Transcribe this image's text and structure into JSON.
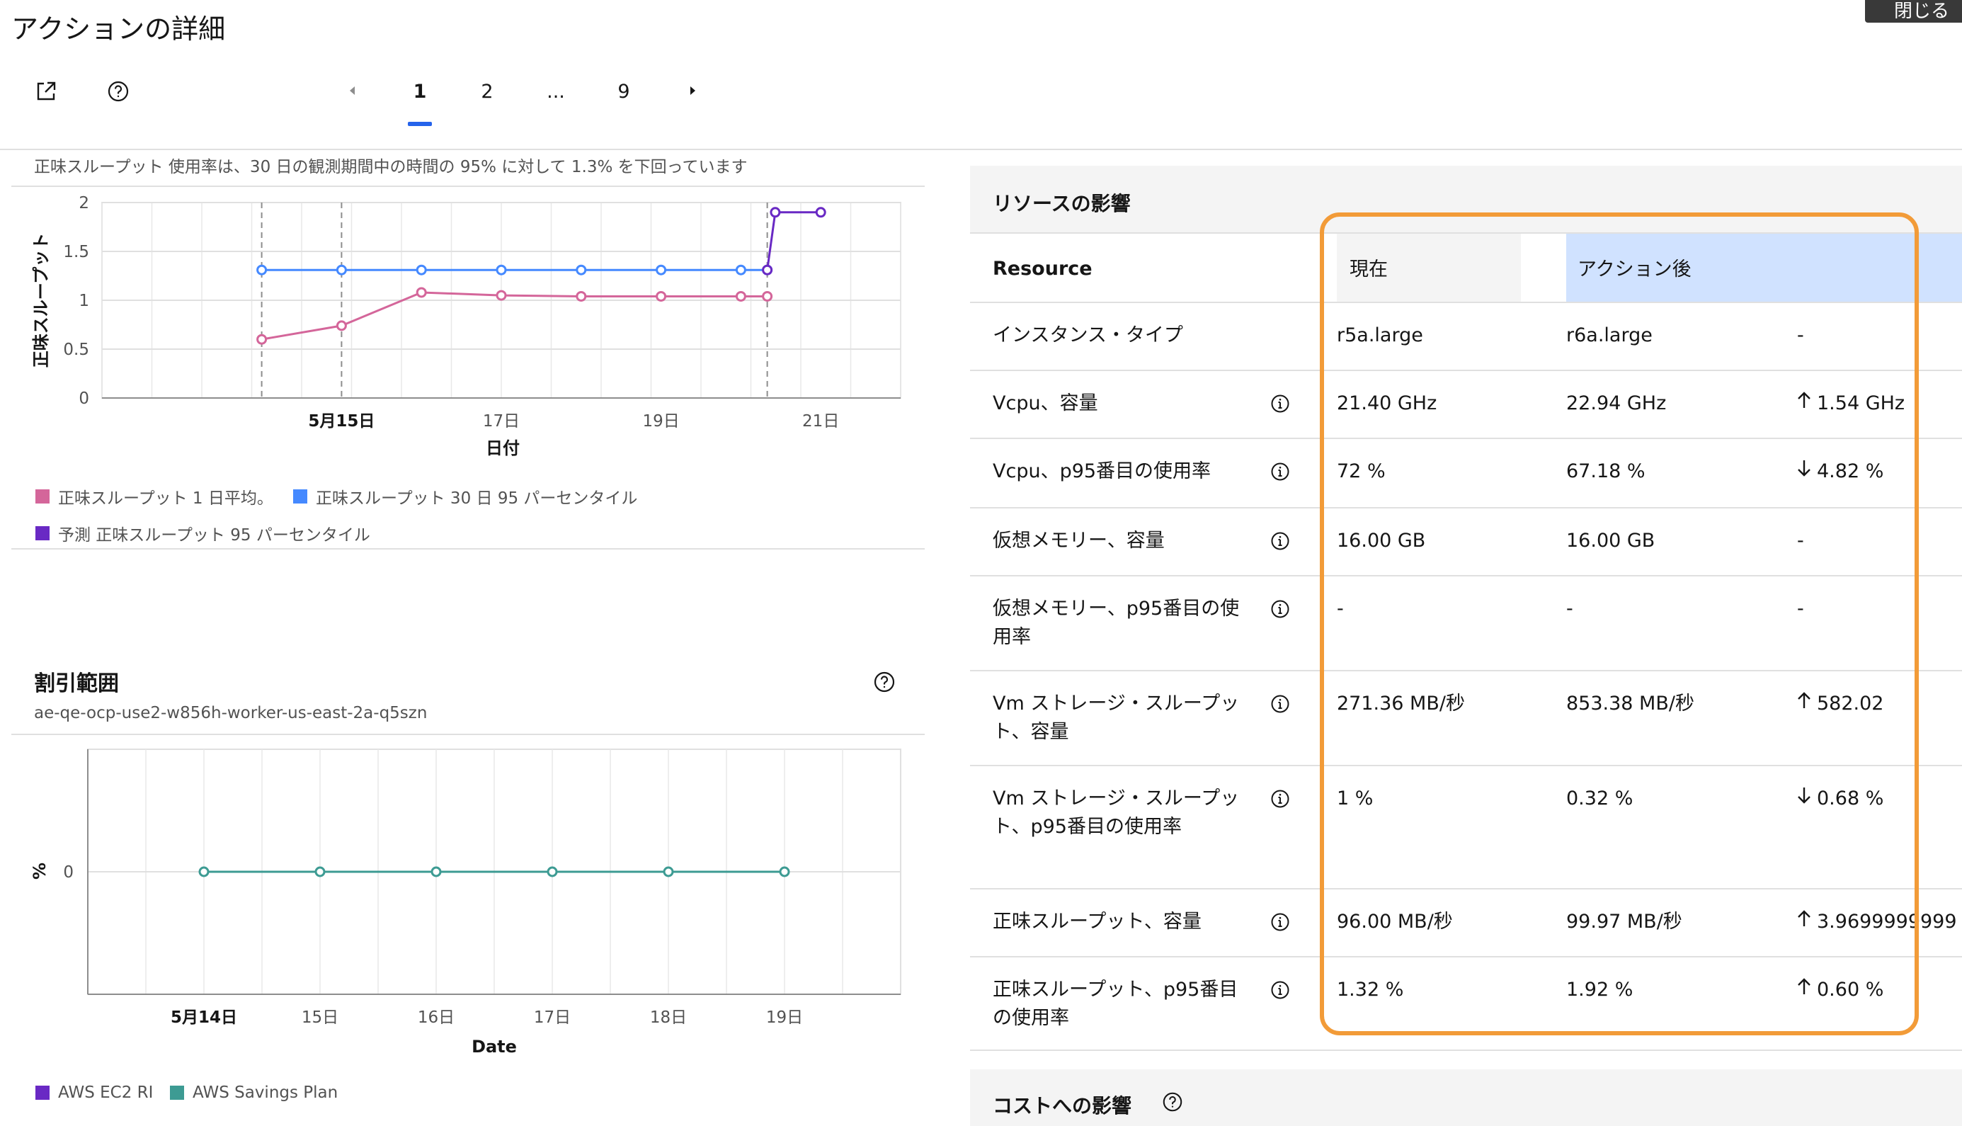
{
  "header": {
    "title": "アクションの詳細",
    "close_label": "閉じる",
    "icons": [
      "external-link-icon",
      "help-icon"
    ],
    "pagination": {
      "pages": [
        "1",
        "2",
        "...",
        "9"
      ],
      "active": "1"
    }
  },
  "throughput_chart": {
    "caption": "正味スループット 使用率は、30 日の観測期間中の時間の 95% に対して 1.3% を下回っています",
    "xlabel": "日付",
    "ylabel": "正味スループット",
    "legend": [
      "正味スループット 1 日平均。",
      "正味スループット 30 日 95 パーセンタイル",
      "予測 正味スループット 95 パーセンタイル"
    ]
  },
  "discount": {
    "title": "割引範囲",
    "subtitle": "ae-qe-ocp-use2-w856h-worker-us-east-2a-q5szn",
    "legend": [
      "AWS EC2 RI",
      "AWS Savings Plan"
    ]
  },
  "chart_data": [
    {
      "type": "line",
      "xlabel": "日付",
      "ylabel": "正味スループット",
      "x_ticks": [
        "5月15日",
        "17日",
        "19日",
        "21日"
      ],
      "y_ticks": [
        "0",
        "0.5",
        "1",
        "1.5",
        "2"
      ],
      "ylim": [
        0,
        2
      ],
      "x_range_days": [
        12,
        22
      ],
      "grid": true,
      "legend_position": "bottom",
      "series": [
        {
          "name": "正味スループット 1 日平均。",
          "color": "#d4669a",
          "points": [
            [
              14.0,
              0.6
            ],
            [
              15.0,
              0.74
            ],
            [
              16.0,
              1.08
            ],
            [
              17.0,
              1.05
            ],
            [
              18.0,
              1.04
            ],
            [
              19.0,
              1.04
            ],
            [
              20.0,
              1.04
            ],
            [
              20.33,
              1.04
            ]
          ]
        },
        {
          "name": "正味スループット 30 日 95 パーセンタイル",
          "color": "#4589ff",
          "points": [
            [
              14.0,
              1.31
            ],
            [
              15.0,
              1.31
            ],
            [
              16.0,
              1.31
            ],
            [
              17.0,
              1.31
            ],
            [
              18.0,
              1.31
            ],
            [
              19.0,
              1.31
            ],
            [
              20.0,
              1.31
            ],
            [
              20.33,
              1.31
            ]
          ]
        },
        {
          "name": "予測 正味スループット 95 パーセンタイル",
          "color": "#6929c4",
          "points": [
            [
              20.33,
              1.31
            ],
            [
              20.43,
              1.9
            ],
            [
              21.0,
              1.9
            ]
          ]
        }
      ]
    },
    {
      "type": "line",
      "xlabel": "Date",
      "ylabel": "%",
      "x_ticks": [
        "5月14日",
        "15日",
        "16日",
        "17日",
        "18日",
        "19日"
      ],
      "y_ticks": [
        "0"
      ],
      "grid": true,
      "legend_position": "bottom",
      "series": [
        {
          "name": "AWS Savings Plan",
          "color": "#3d9b93",
          "points": [
            [
              14,
              0
            ],
            [
              15,
              0
            ],
            [
              16,
              0
            ],
            [
              17,
              0
            ],
            [
              18,
              0
            ],
            [
              19,
              0
            ]
          ]
        }
      ]
    }
  ],
  "resource_impact": {
    "title": "リソースの影響",
    "col_resource": "Resource",
    "col_current": "現在",
    "col_after": "アクション後",
    "rows": [
      {
        "label": "インスタンス・タイプ",
        "current": "r5a.large",
        "after": "r6a.large",
        "change_dir": "",
        "change": "-"
      },
      {
        "label": "Vcpu、容量",
        "current": "21.40 GHz",
        "after": "22.94 GHz",
        "change_dir": "up",
        "change": "1.54 GHz"
      },
      {
        "label": "Vcpu、p95番目の使用率",
        "current": "72 %",
        "after": "67.18 %",
        "change_dir": "down",
        "change": "4.82 %"
      },
      {
        "label": "仮想メモリー、容量",
        "current": "16.00 GB",
        "after": "16.00 GB",
        "change_dir": "",
        "change": "-"
      },
      {
        "label": "仮想メモリー、p95番目の使用率",
        "current": "-",
        "after": "-",
        "change_dir": "",
        "change": "-"
      },
      {
        "label": "Vm ストレージ・スループット、容量",
        "current": "271.36 MB/秒",
        "after": "853.38 MB/秒",
        "change_dir": "up",
        "change": "582.02"
      },
      {
        "label": "Vm ストレージ・スループット、p95番目の使用率",
        "current": "1 %",
        "after": "0.32 %",
        "change_dir": "down",
        "change": "0.68 %"
      },
      {
        "label": "正味スループット、容量",
        "current": "96.00 MB/秒",
        "after": "99.97 MB/秒",
        "change_dir": "up",
        "change": "3.9699999999"
      },
      {
        "label": "正味スループット、p95番目の使用率",
        "current": "1.32 %",
        "after": "1.92 %",
        "change_dir": "up",
        "change": "0.60 %"
      }
    ]
  },
  "cost_impact": {
    "title": "コストへの影響"
  },
  "colors": {
    "accent": "#2563eb",
    "highlight": "#f29b38",
    "after_column": "#d0e2ff"
  }
}
